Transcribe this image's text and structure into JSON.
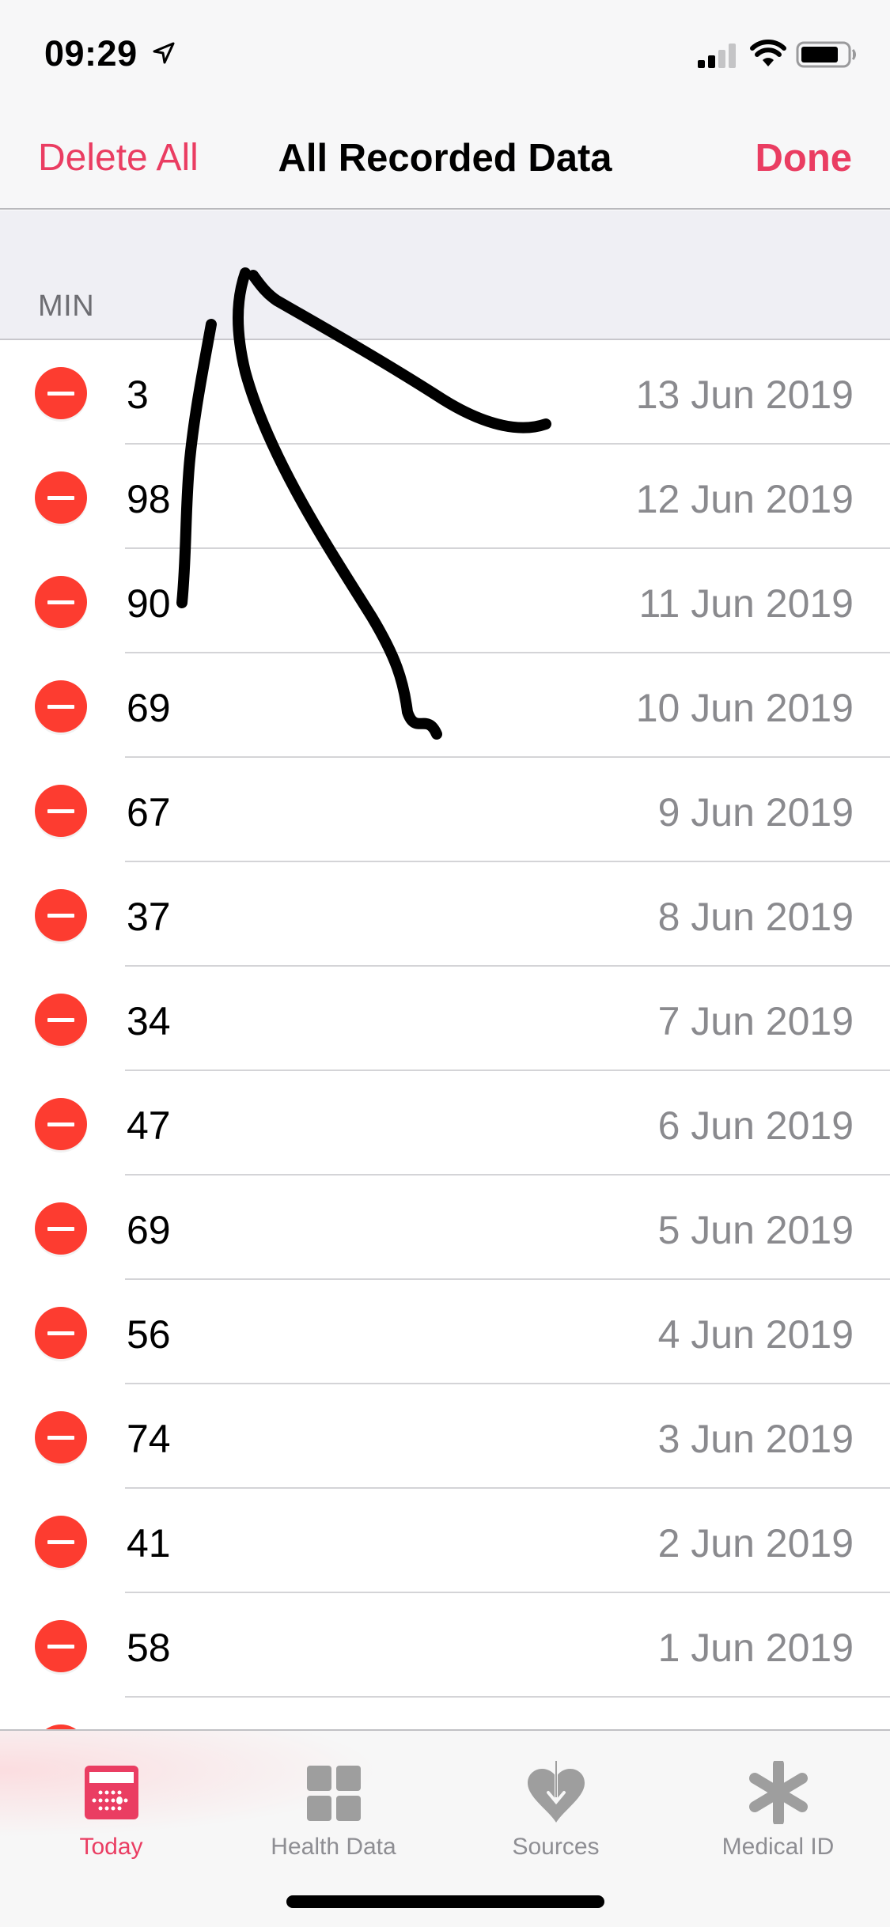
{
  "status_bar": {
    "time": "09:29",
    "location_icon": "location-arrow-icon",
    "signal_icon": "cellular-signal-icon",
    "wifi_icon": "wifi-icon",
    "battery_icon": "battery-icon"
  },
  "nav": {
    "left_button": "Delete All",
    "title": "All Recorded Data",
    "right_button": "Done"
  },
  "section": {
    "header": "MIN"
  },
  "records": [
    {
      "value": "3",
      "date": "13 Jun 2019"
    },
    {
      "value": "98",
      "date": "12 Jun 2019"
    },
    {
      "value": "90",
      "date": "11 Jun 2019"
    },
    {
      "value": "69",
      "date": "10 Jun 2019"
    },
    {
      "value": "67",
      "date": "9 Jun 2019"
    },
    {
      "value": "37",
      "date": "8 Jun 2019"
    },
    {
      "value": "34",
      "date": "7 Jun 2019"
    },
    {
      "value": "47",
      "date": "6 Jun 2019"
    },
    {
      "value": "69",
      "date": "5 Jun 2019"
    },
    {
      "value": "56",
      "date": "4 Jun 2019"
    },
    {
      "value": "74",
      "date": "3 Jun 2019"
    },
    {
      "value": "41",
      "date": "2 Jun 2019"
    },
    {
      "value": "58",
      "date": "1 Jun 2019"
    },
    {
      "value": "",
      "date": ""
    }
  ],
  "tab_bar": {
    "tabs": [
      {
        "label": "Today",
        "icon": "today-calendar-icon",
        "active": true
      },
      {
        "label": "Health Data",
        "icon": "health-data-grid-icon",
        "active": false
      },
      {
        "label": "Sources",
        "icon": "sources-heart-icon",
        "active": false
      },
      {
        "label": "Medical ID",
        "icon": "medical-id-asterisk-icon",
        "active": false
      }
    ]
  },
  "colors": {
    "accent": "#ea3d62",
    "delete": "#fd3c30",
    "secondary_text": "#8a8a8e",
    "inactive_tab": "#8e8e93"
  },
  "annotation": "hand-drawn arrow pointing to MIN header"
}
